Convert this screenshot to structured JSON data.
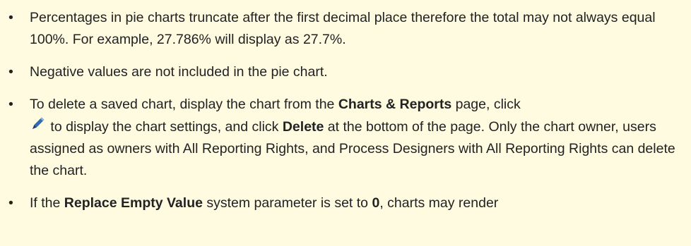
{
  "notes": {
    "item1": {
      "text": "Percentages in pie charts truncate after the first decimal place therefore the total may not always equal 100%. For example, 27.786% will display as 27.7%."
    },
    "item2": {
      "text": "Negative values are not included in the pie chart."
    },
    "item3": {
      "part1": "To delete a saved chart, display the chart from the ",
      "bold1": "Charts & Reports",
      "part2": " page, click ",
      "icon": "pencil-icon",
      "part3": " to display the chart settings, and click ",
      "bold2": "Delete",
      "part4": " at the bottom of the page. Only the chart owner, users assigned as owners with All Reporting Rights, and Process Designers with All Reporting Rights can delete the chart."
    },
    "item4": {
      "part1": "If the ",
      "bold1": "Replace Empty Value",
      "part2": " system parameter is set to ",
      "bold2": "0",
      "part3": ", charts may render"
    }
  },
  "colors": {
    "background": "#FFFBE1",
    "text": "#222222",
    "pencil_body": "#2E6DB4",
    "pencil_tip": "#1D3F6E"
  }
}
